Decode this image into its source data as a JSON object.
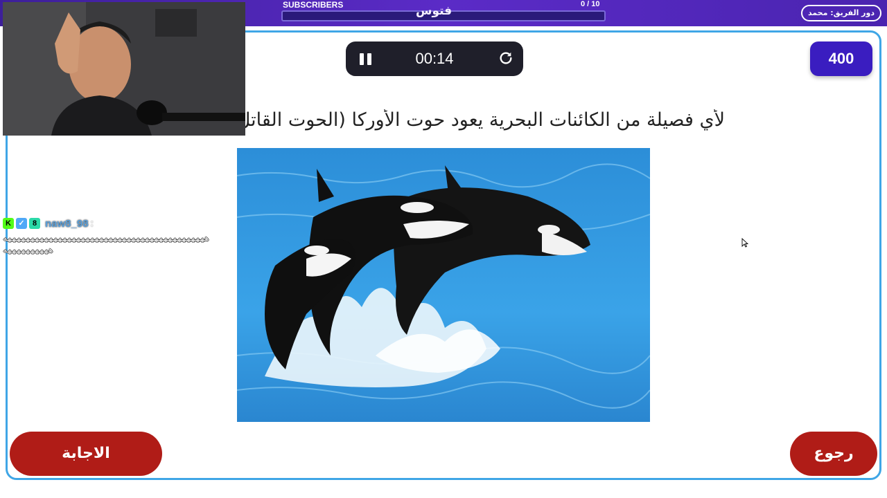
{
  "topbar": {
    "subscribers_label": "SUBSCRIBERS",
    "subscribers_count": "0  / 10",
    "subscribers_progress": 0.0,
    "brand": "فتوس",
    "team_turn": "دور الفريق: محمد"
  },
  "timer": {
    "time": "00:14",
    "pause_icon": "pause-icon",
    "reset_icon": "refresh-icon"
  },
  "points": "400",
  "question": "لأي فصيلة من الكائنات البحرية يعود حوت الأوركا (الحوت القاتل)؟",
  "image_alt_icon": "orca-photo",
  "chat": {
    "badges": [
      "K",
      "✓",
      "8"
    ],
    "username": "naw8_98",
    "separator": ":",
    "message_line1": "ههههههههههههههههههههههههههههههههههههههههههههه",
    "message_line2": "ههههههههههه"
  },
  "buttons": {
    "answer": "الاجابة",
    "back": "رجوع"
  },
  "colors": {
    "topbar": "#4a24b0",
    "frame": "#3fa6e6",
    "points_bg": "#3a1dc0",
    "button_bg": "#b01c17",
    "timer_bg": "#1f1f2a"
  }
}
